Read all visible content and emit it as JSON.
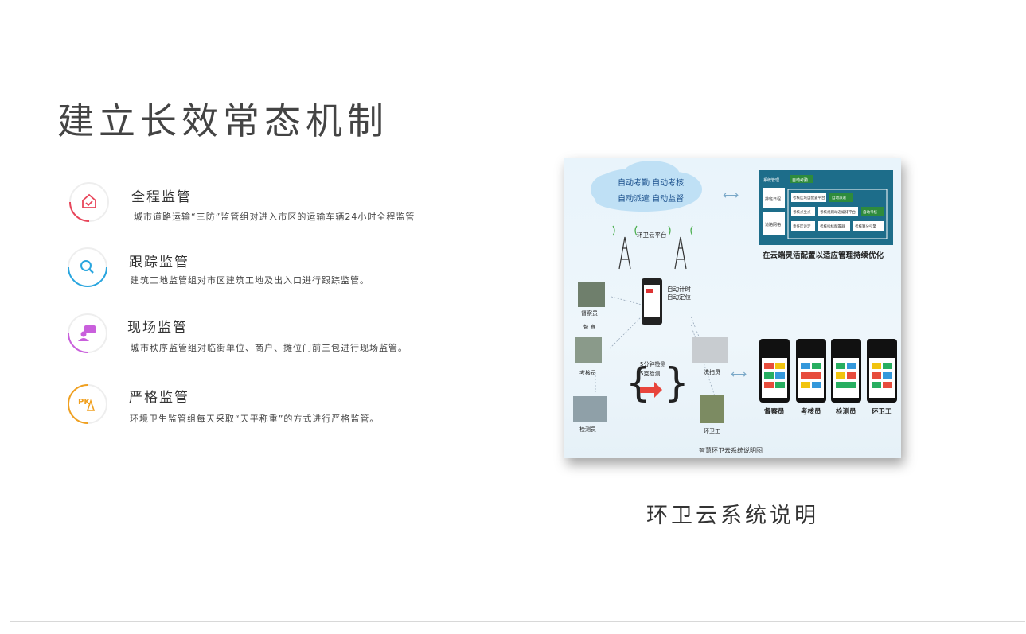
{
  "page": {
    "title": "建立长效常态机制",
    "caption": "环卫云系统说明"
  },
  "items": [
    {
      "title": "全程监管",
      "desc": "城市道路运输“三防”监管组对进入市区的运输车辆24小时全程监管",
      "icon": "house-check-icon",
      "color": "#e8455a"
    },
    {
      "title": "跟踪监管",
      "desc": "建筑工地监管组对市区建筑工地及出入口进行跟踪监管。",
      "icon": "magnifier-icon",
      "color": "#2aa6df"
    },
    {
      "title": "现场监管",
      "desc": "城市秩序监管组对临街单位、商户、摊位门前三包进行现场监管。",
      "icon": "person-chat-icon",
      "color": "#c95fdc"
    },
    {
      "title": "严格监管",
      "desc": "环境卫生监管组每天采取“天平称重”的方式进行严格监管。",
      "icon": "pk-icon",
      "color": "#f0a020"
    }
  ],
  "figure": {
    "cloud_lines": [
      "自动考勤 自动考核",
      "自动派遣 自动监督"
    ],
    "platform_label": "环卫云平台",
    "phone_label_1": "自动计时",
    "phone_label_2": "自动定位",
    "left_roles": [
      "督察员",
      "考核员",
      "检测员"
    ],
    "left_small": "督 察",
    "check_1": "5分钟检测",
    "check_2": "5克检测",
    "right_roles": [
      "洗扫员",
      "环卫工"
    ],
    "panel_header_left": "系统管理",
    "panel_header_btn": "自动考勤",
    "panel_side": [
      "排班日程",
      "道路网格"
    ],
    "panel_row1": [
      "考核区域自配置平台",
      "自动派遣"
    ],
    "panel_row2": [
      "考核点坐点",
      "考核规则动态编排平台",
      "自动考核"
    ],
    "panel_row3": [
      "责任区设定",
      "考核指标配置器",
      "考核算分引擎"
    ],
    "panel_caption": "在云端灵活配置以适应管理持续优化",
    "phone_roles": [
      "督察员",
      "考核员",
      "检测员",
      "环卫工"
    ],
    "figure_caption": "智慧环卫云系统说明图"
  }
}
